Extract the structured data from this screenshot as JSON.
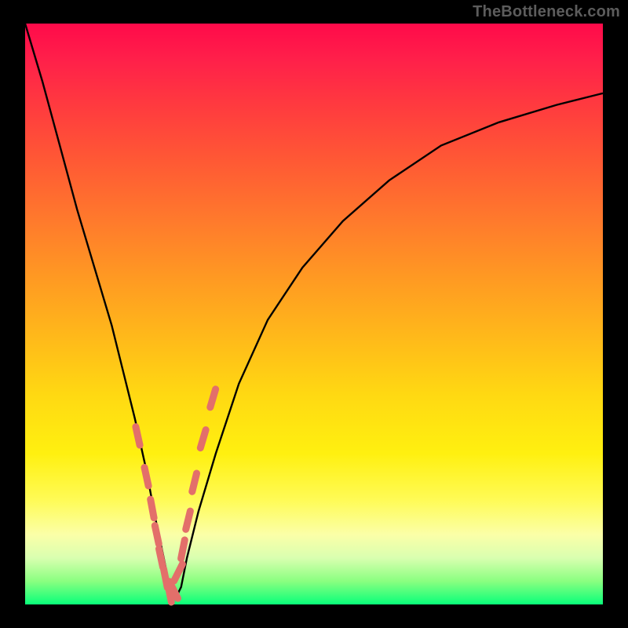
{
  "watermark": "TheBottleneck.com",
  "colors": {
    "curve": "#000000",
    "markers": "#e36f6a",
    "frame": "#000000"
  },
  "chart_data": {
    "type": "line",
    "title": "",
    "xlabel": "",
    "ylabel": "",
    "xlim": [
      0,
      100
    ],
    "ylim": [
      0,
      100
    ],
    "grid": false,
    "note": "Values estimated from plotted curve; x is horizontal position (0=left edge of plot, 100=right edge), y is vertical (0=bottom, 100=top). The curve shows a steep V whose minimum touches the green bottom band.",
    "series": [
      {
        "name": "bottleneck-curve",
        "x": [
          0,
          3,
          6,
          9,
          12,
          15,
          17,
          19,
          21,
          22.5,
          24,
          25,
          26,
          27,
          28,
          30,
          33,
          37,
          42,
          48,
          55,
          63,
          72,
          82,
          92,
          100
        ],
        "y": [
          100,
          90,
          79,
          68,
          58,
          48,
          40,
          32,
          23,
          15,
          8,
          3,
          1,
          3,
          8,
          16,
          26,
          38,
          49,
          58,
          66,
          73,
          79,
          83,
          86,
          88
        ]
      }
    ],
    "markers": {
      "note": "Short salmon tick segments overlaid on the curve near the bottom of the V (highlighted data points).",
      "points_x": [
        19.5,
        21.0,
        22.0,
        22.8,
        23.5,
        24.3,
        25.0,
        25.7,
        26.5,
        27.3,
        28.2,
        29.3,
        30.8,
        32.5
      ],
      "points_y": [
        29.0,
        22.0,
        16.5,
        12.0,
        8.0,
        4.5,
        2.0,
        2.5,
        5.5,
        9.5,
        14.5,
        21.0,
        28.5,
        35.5
      ]
    },
    "background_gradient_stops": [
      {
        "pos": 0.0,
        "color": "#ff0a4a"
      },
      {
        "pos": 0.34,
        "color": "#ff7a2c"
      },
      {
        "pos": 0.64,
        "color": "#ffd912"
      },
      {
        "pos": 0.88,
        "color": "#fbffa8"
      },
      {
        "pos": 1.0,
        "color": "#09ff7a"
      }
    ]
  }
}
